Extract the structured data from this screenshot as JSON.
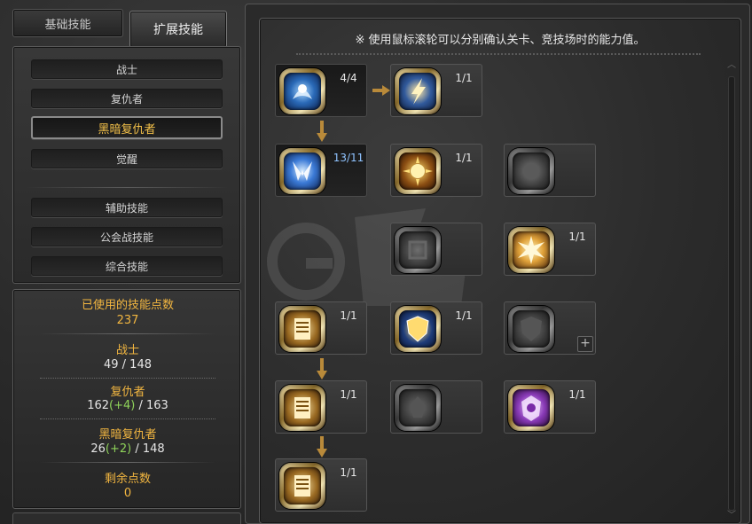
{
  "tabs": {
    "basic": "基础技能",
    "extended": "扩展技能"
  },
  "classes": {
    "warrior": "战士",
    "avenger": "复仇者",
    "dark_avenger": "黑暗复仇者",
    "awaken": "觉醒",
    "support": "辅助技能",
    "guild_war": "公会战技能",
    "general": "综合技能"
  },
  "points": {
    "used_label": "已使用的技能点数",
    "used_value": "237",
    "warrior_label": "战士",
    "warrior_value": "49 / 148",
    "avenger_label": "复仇者",
    "avenger_base": "162",
    "avenger_bonus": "(+4)",
    "avenger_max": " / 163",
    "dark_label": "黑暗复仇者",
    "dark_base": "26",
    "dark_bonus": "(+2)",
    "dark_max": " / 148",
    "remain_label": "剩余点数",
    "remain_value": "0"
  },
  "hint": "※ 使用鼠标滚轮可以分别确认关卡、竞技场时的能力值。",
  "skills": [
    {
      "id": "s1",
      "level": "4/4"
    },
    {
      "id": "s2",
      "level": "1/1"
    },
    {
      "id": "s3",
      "level": "13/11"
    },
    {
      "id": "s4",
      "level": "1/1"
    },
    {
      "id": "s5",
      "level": ""
    },
    {
      "id": "s6",
      "level": ""
    },
    {
      "id": "s7",
      "level": "1/1"
    },
    {
      "id": "s8",
      "level": "1/1"
    },
    {
      "id": "s9",
      "level": "1/1"
    },
    {
      "id": "s10",
      "level": ""
    },
    {
      "id": "s11",
      "level": "1/1"
    },
    {
      "id": "s12",
      "level": ""
    },
    {
      "id": "s13",
      "level": "1/1"
    },
    {
      "id": "s14",
      "level": "1/1"
    }
  ]
}
